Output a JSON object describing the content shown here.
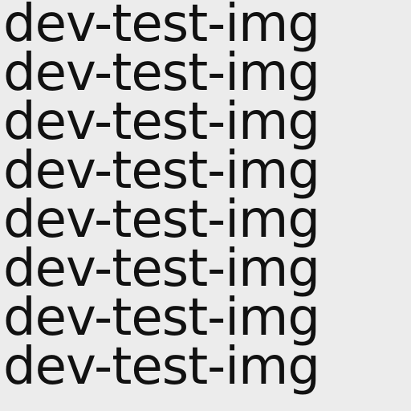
{
  "lines": [
    "dev-test-img",
    "dev-test-img",
    "dev-test-img",
    "dev-test-img",
    "dev-test-img",
    "dev-test-img",
    "dev-test-img",
    "dev-test-img"
  ],
  "colors": {
    "background": "#ececec",
    "text": "#111111"
  }
}
